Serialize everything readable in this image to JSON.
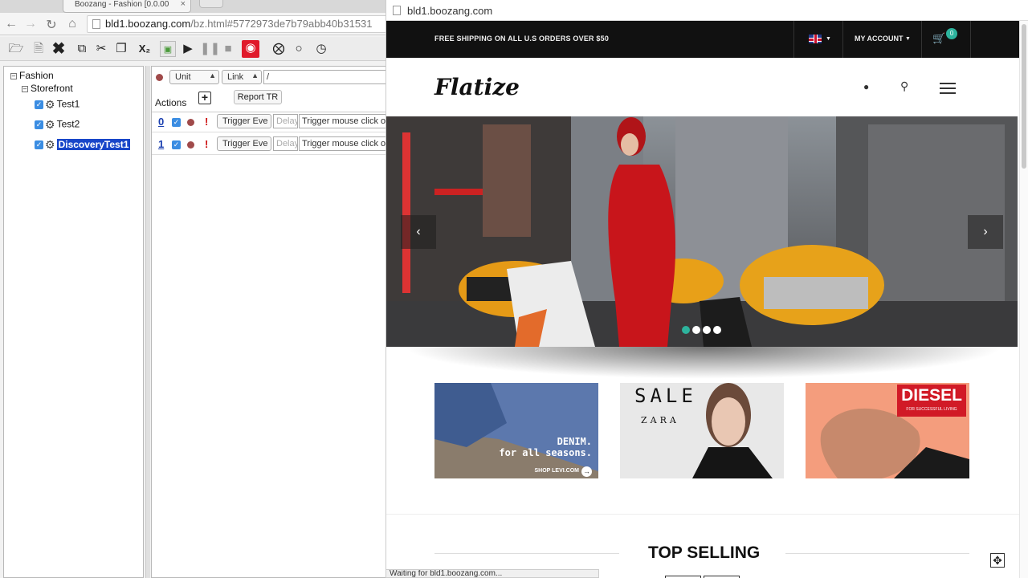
{
  "browser": {
    "tab_title": "Boozang - Fashion [0.0.00",
    "tab_close": "×",
    "address_domain": "bld1.boozang.com",
    "address_path": "/bz.html#5772973de7b79abb40b31531",
    "status": "Waiting for bld1.boozang.com..."
  },
  "tree": {
    "root": "Fashion",
    "module": "Storefront",
    "tests": [
      "Test1",
      "Test2",
      "DiscoveryTest1"
    ]
  },
  "editor": {
    "unit_select": "Unit",
    "link_select": "Link",
    "path_value": "/",
    "actions_label": "Actions",
    "add_icon": "+",
    "report_button": "Report TR",
    "rows": [
      {
        "index": "0",
        "type": "Trigger Eve",
        "delay_placeholder": "Delay",
        "description": "Trigger mouse click on"
      },
      {
        "index": "1",
        "type": "Trigger Eve",
        "delay_placeholder": "Delay",
        "description": "Trigger mouse click on"
      }
    ]
  },
  "popup": {
    "url": "bld1.boozang.com",
    "shipping_text": "FREE SHIPPING ON ALL U.S ORDERS OVER $50",
    "account_label": "MY ACCOUNT",
    "cart_count": "0",
    "logo": "Flatize",
    "carousel": {
      "prev": "‹",
      "next": "›",
      "slides": 4,
      "active": 0
    },
    "promos": {
      "levi_line1": "DENIM.",
      "levi_line2": "for all seasons.",
      "levi_shop": "SHOP LEVI.COM",
      "zara_sale": "SALE",
      "zara_brand": "ZARA",
      "diesel_brand": "DIESEL",
      "diesel_tag": "FOR SUCCESSFUL LIVING"
    },
    "top_selling": "TOP SELLING"
  },
  "colors": {
    "accent_teal": "#2db39d",
    "record_red": "#e0192a",
    "selection_blue": "#1846c9"
  }
}
